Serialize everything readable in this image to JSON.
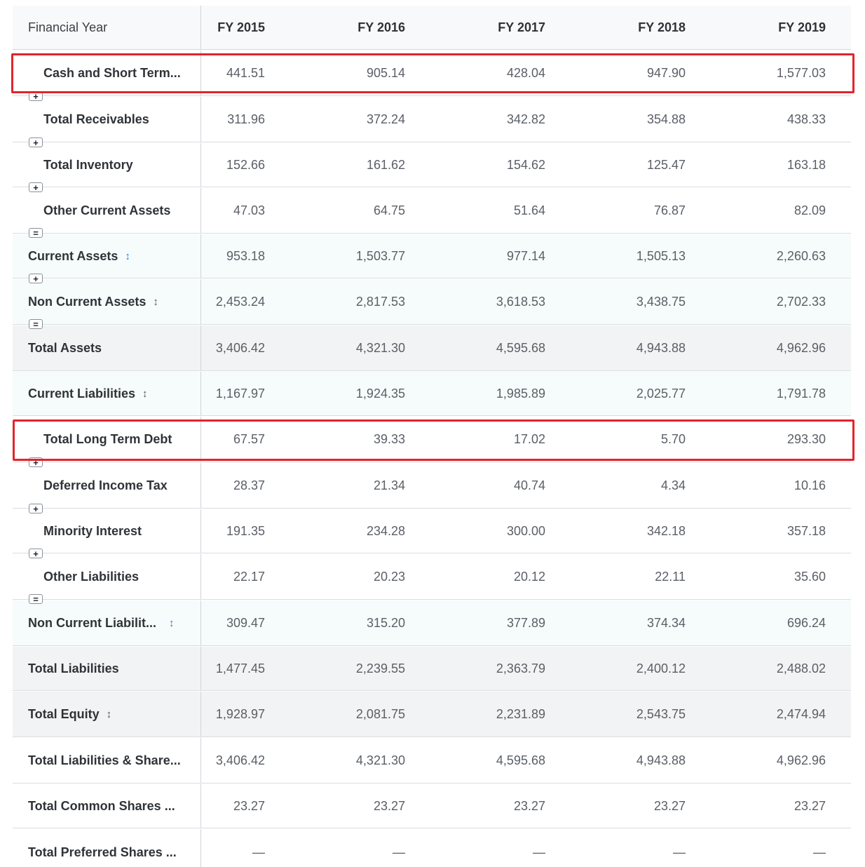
{
  "header": {
    "label": "Financial Year",
    "years": [
      "FY 2015",
      "FY 2016",
      "FY 2017",
      "FY 2018",
      "FY 2019"
    ]
  },
  "rows": [
    {
      "label": "Cash and Short Term...",
      "values": [
        "441.51",
        "905.14",
        "428.04",
        "947.90",
        "1,577.03"
      ]
    },
    {
      "label": "Total Receivables",
      "values": [
        "311.96",
        "372.24",
        "342.82",
        "354.88",
        "438.33"
      ]
    },
    {
      "label": "Total Inventory",
      "values": [
        "152.66",
        "161.62",
        "154.62",
        "125.47",
        "163.18"
      ]
    },
    {
      "label": "Other Current Assets",
      "values": [
        "47.03",
        "64.75",
        "51.64",
        "76.87",
        "82.09"
      ]
    },
    {
      "label": "Current Assets",
      "values": [
        "953.18",
        "1,503.77",
        "977.14",
        "1,505.13",
        "2,260.63"
      ]
    },
    {
      "label": "Non Current Assets",
      "values": [
        "2,453.24",
        "2,817.53",
        "3,618.53",
        "3,438.75",
        "2,702.33"
      ]
    },
    {
      "label": "Total Assets",
      "values": [
        "3,406.42",
        "4,321.30",
        "4,595.68",
        "4,943.88",
        "4,962.96"
      ]
    },
    {
      "label": "Current Liabilities",
      "values": [
        "1,167.97",
        "1,924.35",
        "1,985.89",
        "2,025.77",
        "1,791.78"
      ]
    },
    {
      "label": "Total Long Term Debt",
      "values": [
        "67.57",
        "39.33",
        "17.02",
        "5.70",
        "293.30"
      ]
    },
    {
      "label": "Deferred Income Tax",
      "values": [
        "28.37",
        "21.34",
        "40.74",
        "4.34",
        "10.16"
      ]
    },
    {
      "label": "Minority Interest",
      "values": [
        "191.35",
        "234.28",
        "300.00",
        "342.18",
        "357.18"
      ]
    },
    {
      "label": "Other Liabilities",
      "values": [
        "22.17",
        "20.23",
        "20.12",
        "22.11",
        "35.60"
      ]
    },
    {
      "label": "Non Current Liabilit...",
      "values": [
        "309.47",
        "315.20",
        "377.89",
        "374.34",
        "696.24"
      ]
    },
    {
      "label": "Total Liabilities",
      "values": [
        "1,477.45",
        "2,239.55",
        "2,363.79",
        "2,400.12",
        "2,488.02"
      ]
    },
    {
      "label": "Total Equity",
      "values": [
        "1,928.97",
        "2,081.75",
        "2,231.89",
        "2,543.75",
        "2,474.94"
      ]
    },
    {
      "label": "Total Liabilities & Share...",
      "values": [
        "3,406.42",
        "4,321.30",
        "4,595.68",
        "4,943.88",
        "4,962.96"
      ]
    },
    {
      "label": "Total Common Shares ...",
      "values": [
        "23.27",
        "23.27",
        "23.27",
        "23.27",
        "23.27"
      ]
    },
    {
      "label": "Total Preferred Shares ...",
      "values": [
        "—",
        "—",
        "—",
        "—",
        "—"
      ]
    }
  ],
  "operators": {
    "plus": "+",
    "equals": "="
  },
  "sort_icon": "↕",
  "colors": {
    "highlight": "#e3242b",
    "sort_active": "#2f80ed",
    "subtotal_bg": "#f6fcfc",
    "total_bg": "#f2f3f4"
  }
}
